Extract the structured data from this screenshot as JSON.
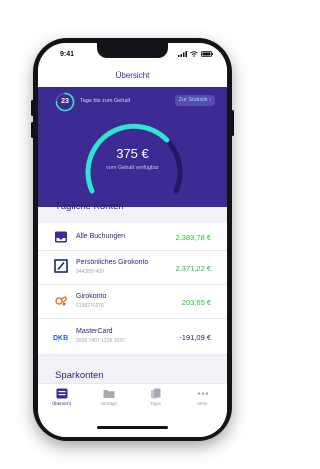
{
  "status": {
    "time": "9:41"
  },
  "header": {
    "title": "Übersicht"
  },
  "hero": {
    "days_count": "23",
    "days_label": "Tage bis zum Gehalt",
    "stat_button": "Zur Statistik ›",
    "amount": "375 €",
    "amount_label": "vom Gehalt verfügbar",
    "gauge_fill_fraction": 0.7,
    "days_fill_fraction": 0.75
  },
  "sections": {
    "daily_title": "Tägliche Konten",
    "savings_title": "Sparkonten"
  },
  "accounts": [
    {
      "name": "Alle Buchungen",
      "number": "",
      "amount": "2.383,78 €",
      "icon": "inbox-icon",
      "amount_color": "#1fbf3a"
    },
    {
      "name": "Persönliches Girokonto",
      "number": "0443897400",
      "amount": "2.371,22 €",
      "icon": "deutsche-bank-logo-icon",
      "amount_color": "#1fbf3a"
    },
    {
      "name": "Girokonto",
      "number": "0198276276",
      "amount": "203,65 €",
      "icon": "bank-logo-icon",
      "amount_color": "#1fbf3a"
    },
    {
      "name": "MasterCard",
      "number": "5526 7407 1229 1037",
      "amount": "-191,09 €",
      "icon": "dkb-logo-icon",
      "amount_color": "#2b1f73"
    }
  ],
  "tabs": [
    {
      "label": "Übersicht",
      "icon": "overview-icon",
      "active": true
    },
    {
      "label": "Verträge",
      "icon": "folder-icon",
      "active": false
    },
    {
      "label": "Tipps",
      "icon": "cards-icon",
      "active": false
    },
    {
      "label": "Mehr",
      "icon": "more-icon",
      "active": false
    }
  ],
  "colors": {
    "accent": "#3d2a93",
    "gauge": "#2ee6d0",
    "positive": "#1fbf3a"
  }
}
